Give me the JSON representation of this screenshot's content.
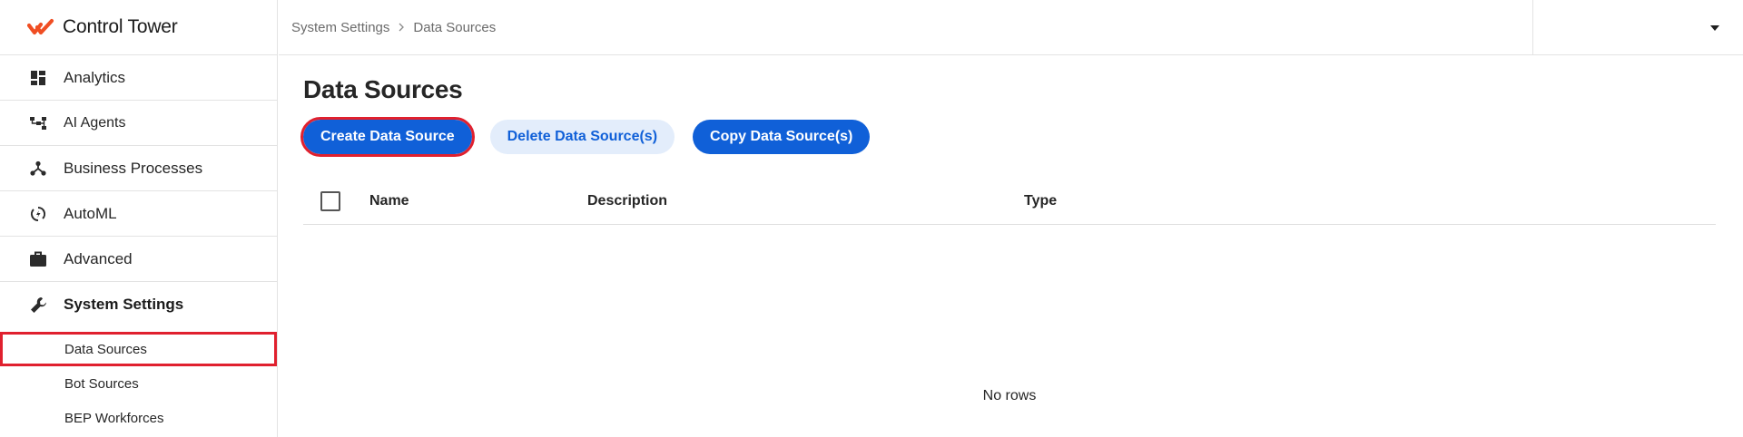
{
  "app": {
    "title": "Control Tower",
    "brand_color": "#f04e23"
  },
  "sidebar": {
    "items": [
      {
        "label": "Analytics",
        "icon": "dashboard-icon"
      },
      {
        "label": "AI Agents",
        "icon": "hierarchy-icon"
      },
      {
        "label": "Business Processes",
        "icon": "process-icon"
      },
      {
        "label": "AutoML",
        "icon": "automl-icon"
      },
      {
        "label": "Advanced",
        "icon": "briefcase-icon"
      },
      {
        "label": "System Settings",
        "icon": "wrench-icon",
        "active": true
      }
    ],
    "sub_items": [
      {
        "label": "Data Sources",
        "selected": true
      },
      {
        "label": "Bot Sources"
      },
      {
        "label": "BEP Workforces"
      }
    ]
  },
  "header": {
    "breadcrumb": [
      "System Settings",
      "Data Sources"
    ]
  },
  "main": {
    "title": "Data Sources",
    "buttons": {
      "create": "Create Data Source",
      "delete": "Delete Data Source(s)",
      "copy": "Copy Data Source(s)"
    },
    "table": {
      "columns": [
        "Name",
        "Description",
        "Type"
      ],
      "empty_text": "No rows"
    }
  },
  "colors": {
    "primary": "#1060d8",
    "soft": "#e3edfb",
    "highlight": "#e0202e"
  }
}
